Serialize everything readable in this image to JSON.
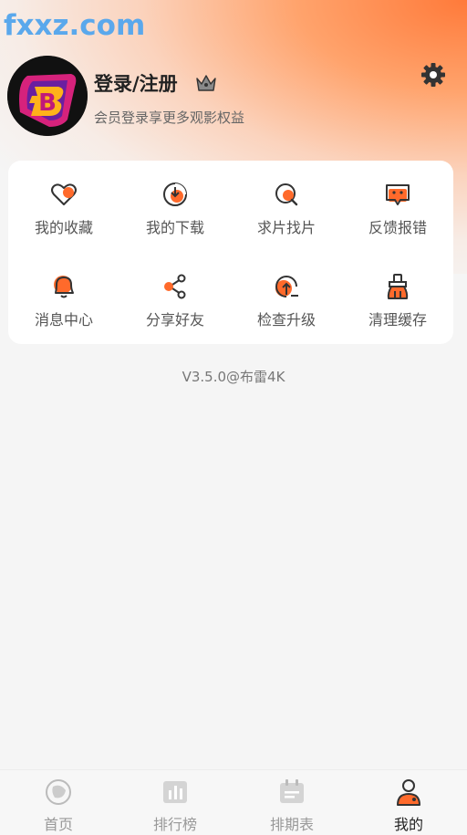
{
  "watermark": "fxxz.com",
  "profile": {
    "title": "登录/注册",
    "subtitle": "会员登录享更多观影权益",
    "avatar_letter": "B"
  },
  "colors": {
    "accent": "#ff6a2b",
    "header_gradient_start": "#ff7a3a",
    "watermark": "#5aa8ec",
    "icon_stroke": "#333333"
  },
  "menu": {
    "items": [
      {
        "label": "我的收藏",
        "icon": "heart-icon"
      },
      {
        "label": "我的下载",
        "icon": "download-icon"
      },
      {
        "label": "求片找片",
        "icon": "search-icon"
      },
      {
        "label": "反馈报错",
        "icon": "feedback-icon"
      },
      {
        "label": "消息中心",
        "icon": "bell-icon"
      },
      {
        "label": "分享好友",
        "icon": "share-icon"
      },
      {
        "label": "检查升级",
        "icon": "upgrade-icon"
      },
      {
        "label": "清理缓存",
        "icon": "broom-icon"
      }
    ]
  },
  "version": "V3.5.0@布雷4K",
  "tabs": [
    {
      "label": "首页",
      "icon": "home-icon",
      "active": false
    },
    {
      "label": "排行榜",
      "icon": "ranking-icon",
      "active": false
    },
    {
      "label": "排期表",
      "icon": "calendar-icon",
      "active": false
    },
    {
      "label": "我的",
      "icon": "profile-icon",
      "active": true
    }
  ]
}
